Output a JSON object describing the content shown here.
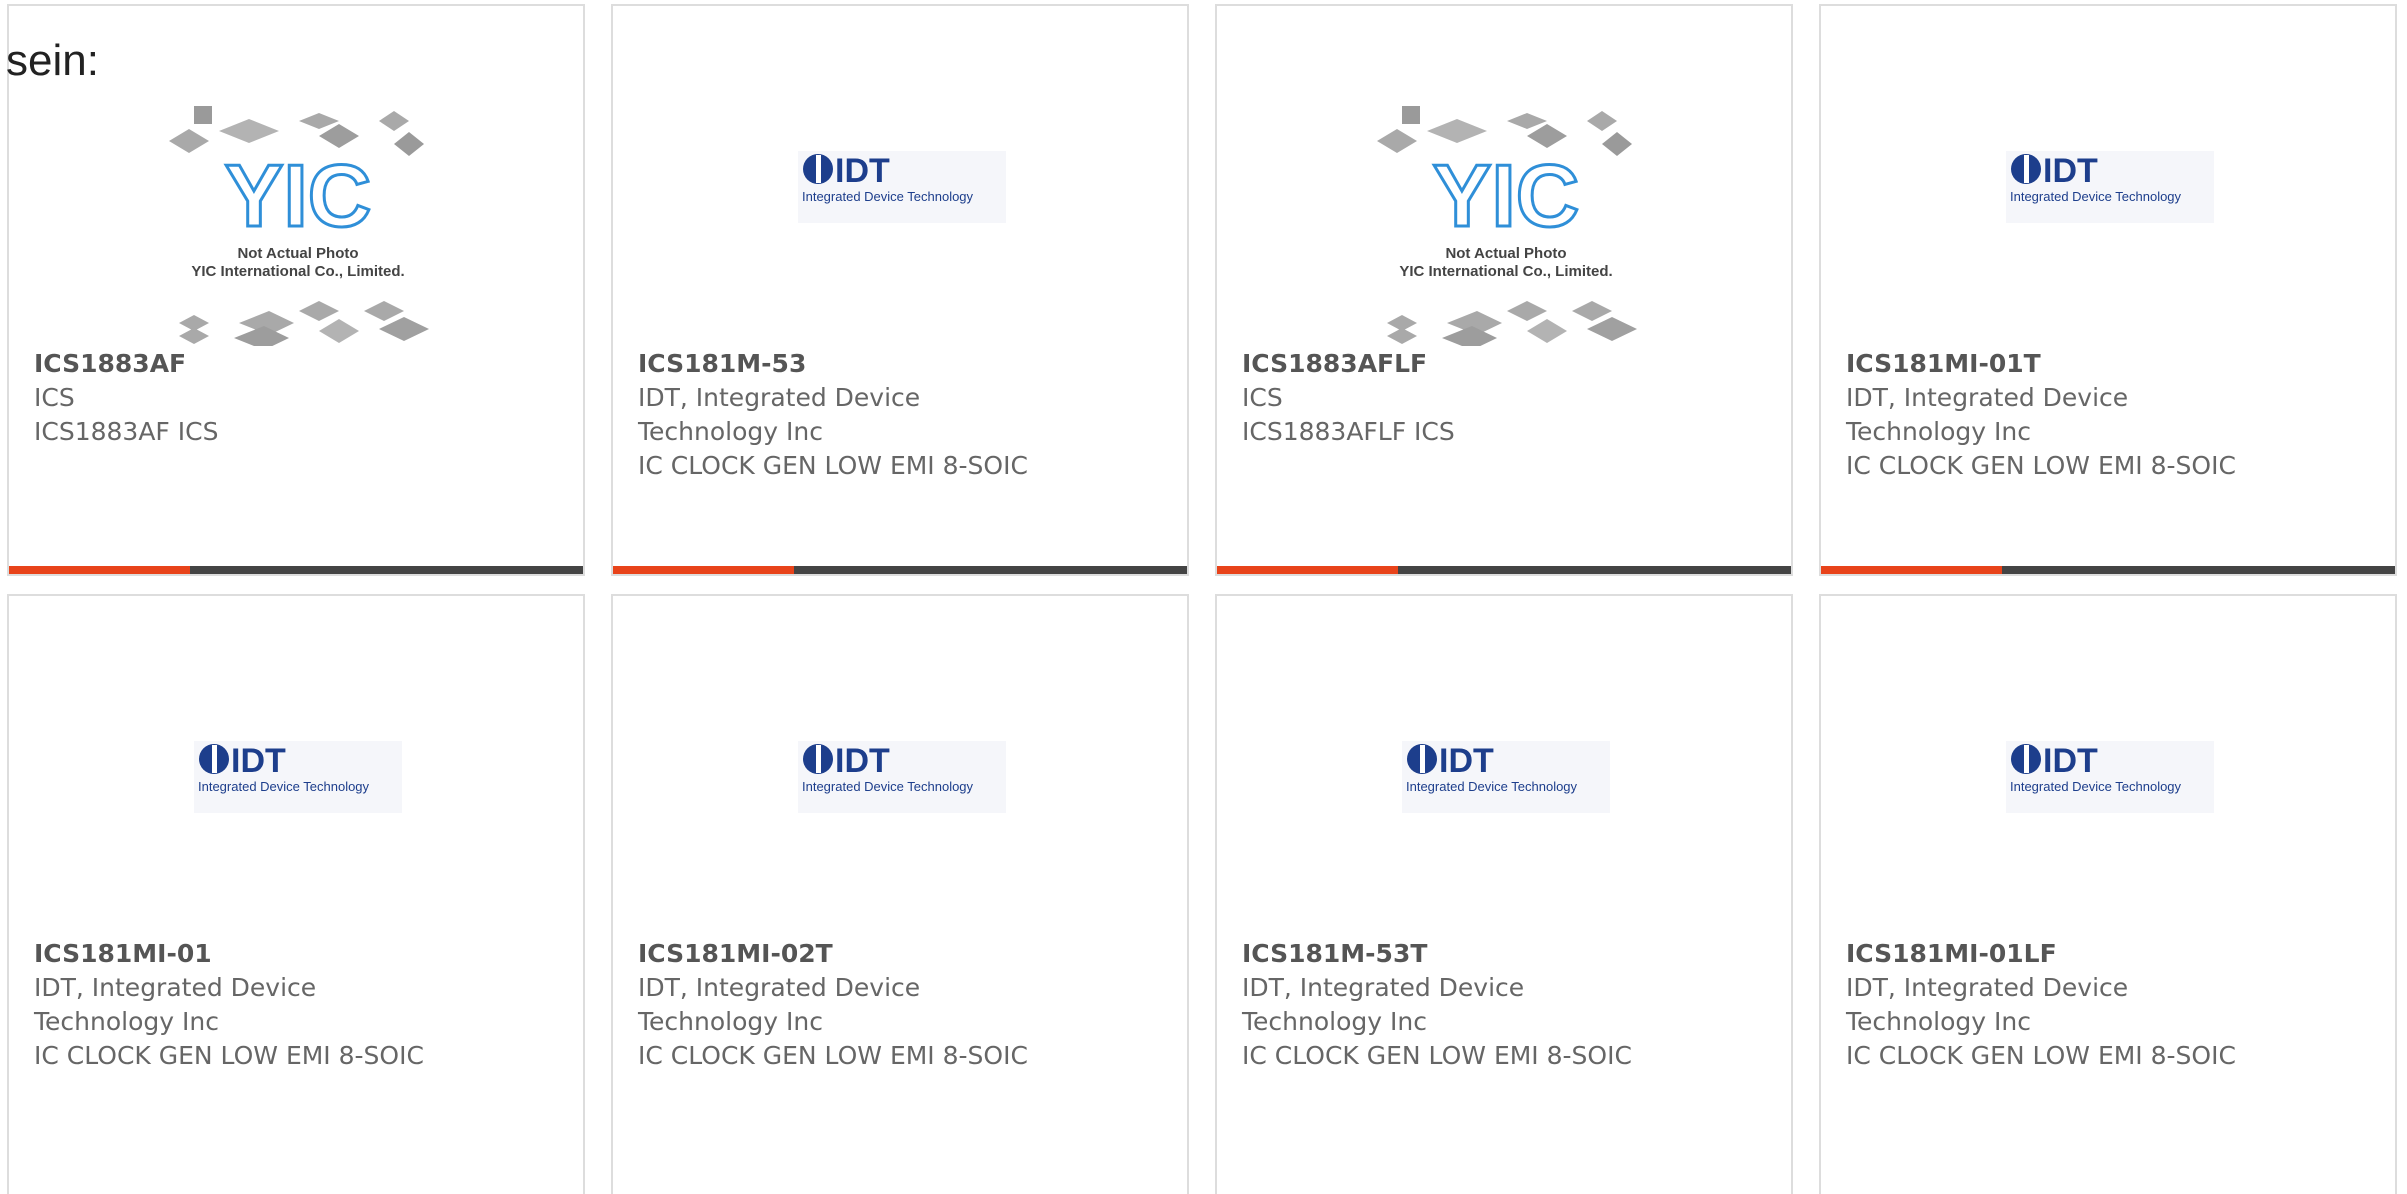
{
  "page": {
    "label": "sein:"
  },
  "colors": {
    "accent": "#e8431a",
    "bar": "#444444",
    "idt_blue": "#1d3e8c",
    "yic_blue": "#2f8fd8",
    "border": "#dddddd"
  },
  "cards": [
    {
      "part": "ICS1883AF",
      "manufacturer": "ICS",
      "description": "ICS1883AF ICS",
      "image": "yic",
      "yic_note1": "Not Actual Photo",
      "yic_note2": "YIC International Co., Limited.",
      "progress": 0.315
    },
    {
      "part": "ICS181M-53",
      "manufacturer": "IDT, Integrated Device Technology Inc",
      "description": "IC CLOCK GEN LOW EMI 8-SOIC",
      "image": "idt",
      "idt_name": "IDT",
      "idt_sub": "Integrated Device Technology",
      "progress": 0.315
    },
    {
      "part": "ICS1883AFLF",
      "manufacturer": "ICS",
      "description": "ICS1883AFLF ICS",
      "image": "yic",
      "yic_note1": "Not Actual Photo",
      "yic_note2": "YIC International Co., Limited.",
      "progress": 0.315
    },
    {
      "part": "ICS181MI-01T",
      "manufacturer": "IDT, Integrated Device Technology Inc",
      "description": "IC CLOCK GEN LOW EMI 8-SOIC",
      "image": "idt",
      "idt_name": "IDT",
      "idt_sub": "Integrated Device Technology",
      "progress": 0.315
    },
    {
      "part": "ICS181MI-01",
      "manufacturer": "IDT, Integrated Device Technology Inc",
      "description": "IC CLOCK GEN LOW EMI 8-SOIC",
      "image": "idt",
      "idt_name": "IDT",
      "idt_sub": "Integrated Device Technology"
    },
    {
      "part": "ICS181MI-02T",
      "manufacturer": "IDT, Integrated Device Technology Inc",
      "description": "IC CLOCK GEN LOW EMI 8-SOIC",
      "image": "idt",
      "idt_name": "IDT",
      "idt_sub": "Integrated Device Technology"
    },
    {
      "part": "ICS181M-53T",
      "manufacturer": "IDT, Integrated Device Technology Inc",
      "description": "IC CLOCK GEN LOW EMI 8-SOIC",
      "image": "idt",
      "idt_name": "IDT",
      "idt_sub": "Integrated Device Technology"
    },
    {
      "part": "ICS181MI-01LF",
      "manufacturer": "IDT, Integrated Device Technology Inc",
      "description": "IC CLOCK GEN LOW EMI 8-SOIC",
      "image": "idt",
      "idt_name": "IDT",
      "idt_sub": "Integrated Device Technology"
    }
  ]
}
